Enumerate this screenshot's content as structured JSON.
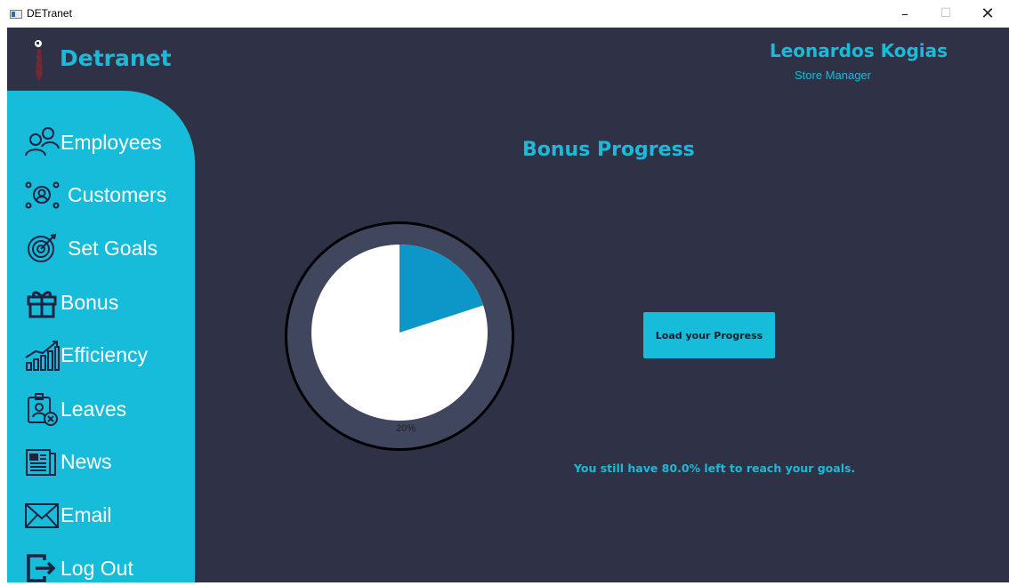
{
  "window": {
    "title": "DETranet",
    "controls": [
      "minimize-icon",
      "maximize-icon",
      "close-icon"
    ]
  },
  "brand": {
    "name": "Detranet",
    "icon": "tie-logo-icon"
  },
  "user": {
    "name": "Leonardos Kogias",
    "role": "Store Manager"
  },
  "sidebar": {
    "items": [
      {
        "label": "Employees",
        "icon": "employees-icon"
      },
      {
        "label": "Customers",
        "icon": "customers-icon"
      },
      {
        "label": "Set Goals",
        "icon": "target-icon"
      },
      {
        "label": "Bonus",
        "icon": "gift-icon"
      },
      {
        "label": "Efficiency",
        "icon": "chart-growth-icon"
      },
      {
        "label": "Leaves",
        "icon": "leave-badge-icon"
      },
      {
        "label": "News",
        "icon": "newspaper-icon"
      },
      {
        "label": "Email",
        "icon": "envelope-icon"
      },
      {
        "label": "Log Out",
        "icon": "logout-icon"
      }
    ]
  },
  "main": {
    "title": "Bonus Progress",
    "progress_label": "20%",
    "load_button": "Load your Progress",
    "status": "You still have 80.0% left to reach your goals."
  },
  "colors": {
    "accent": "#16bcd9",
    "background": "#2f3246",
    "ring": "#41465f",
    "slice": "#0c97c8"
  },
  "chart_data": {
    "type": "pie",
    "values": [
      20,
      80
    ],
    "labels": [
      "20%",
      ""
    ],
    "colors": [
      "#0c97c8",
      "#ffffff"
    ]
  }
}
